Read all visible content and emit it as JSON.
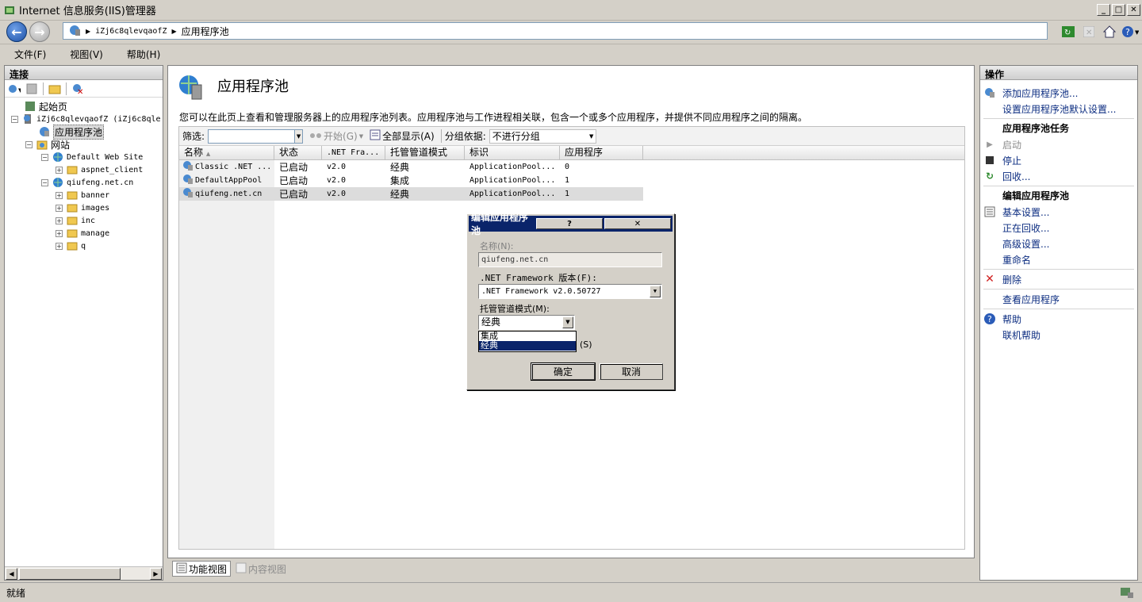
{
  "window": {
    "title": "Internet 信息服务(IIS)管理器"
  },
  "address": {
    "crumbs": [
      "iZj6c8qlevqaofZ",
      "应用程序池"
    ]
  },
  "menu": {
    "items": [
      "文件(F)",
      "视图(V)",
      "帮助(H)"
    ]
  },
  "connections": {
    "header": "连接",
    "tree": {
      "start_page": "起始页",
      "server": "iZj6c8qlevqaofZ (iZj6c8qle",
      "app_pools": "应用程序池",
      "sites": "网站",
      "default_site": "Default Web Site",
      "aspnet_client": "aspnet_client",
      "qiufeng": "qiufeng.net.cn",
      "banner": "banner",
      "images": "images",
      "inc": "inc",
      "manage": "manage",
      "q": "q"
    }
  },
  "main": {
    "title": "应用程序池",
    "description": "您可以在此页上查看和管理服务器上的应用程序池列表。应用程序池与工作进程相关联，包含一个或多个应用程序，并提供不同应用程序之间的隔离。",
    "filter_label": "筛选:",
    "start_label": "开始(G)",
    "show_all_label": "全部显示(A)",
    "groupby_label": "分组依据:",
    "groupby_value": "不进行分组",
    "columns": [
      "名称",
      "状态",
      ".NET Fra...",
      "托管管道模式",
      "标识",
      "应用程序"
    ],
    "rows": [
      [
        "Classic .NET ...",
        "已启动",
        "v2.0",
        "经典",
        "ApplicationPool...",
        "0"
      ],
      [
        "DefaultAppPool",
        "已启动",
        "v2.0",
        "集成",
        "ApplicationPool...",
        "1"
      ],
      [
        "qiufeng.net.cn",
        "已启动",
        "v2.0",
        "经典",
        "ApplicationPool...",
        "1"
      ]
    ]
  },
  "viewtabs": {
    "features": "功能视图",
    "content": "内容视图"
  },
  "actions": {
    "header": "操作",
    "add_pool": "添加应用程序池...",
    "set_defaults": "设置应用程序池默认设置...",
    "tasks_head": "应用程序池任务",
    "start": "启动",
    "stop": "停止",
    "recycle": "回收...",
    "edit_head": "编辑应用程序池",
    "basic": "基本设置...",
    "recycling": "正在回收...",
    "advanced": "高级设置...",
    "rename": "重命名",
    "delete": "删除",
    "view_apps": "查看应用程序",
    "help": "帮助",
    "online_help": "联机帮助"
  },
  "status": {
    "text": "就绪"
  },
  "dialog": {
    "title": "编辑应用程序池",
    "name_label": "名称(N):",
    "name_value": "qiufeng.net.cn",
    "framework_label": ".NET Framework 版本(F):",
    "framework_value": ".NET Framework v2.0.50727",
    "pipeline_label": "托管管道模式(M):",
    "pipeline_value": "经典",
    "options": [
      "集成",
      "经典"
    ],
    "hidden_suffix": "(S)",
    "ok": "确定",
    "cancel": "取消"
  },
  "colors": {
    "link": "#0b2c80",
    "selection": "#0a246a",
    "chrome": "#d4d0c8"
  }
}
